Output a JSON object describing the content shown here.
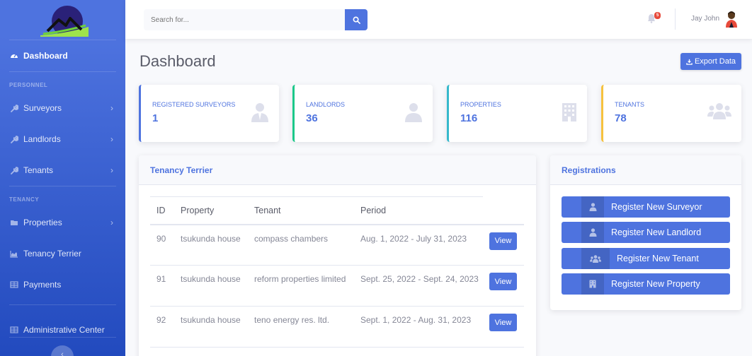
{
  "sidebar": {
    "dashboard": "Dashboard",
    "heading_personnel": "PERSONNEL",
    "surveyors": "Surveyors",
    "landlords": "Landlords",
    "tenants": "Tenants",
    "heading_tenancy": "TENANCY",
    "properties": "Properties",
    "tenancy_terrier": "Tenancy Terrier",
    "payments": "Payments",
    "admin_center": "Administrative Center"
  },
  "topbar": {
    "search_placeholder": "Search for...",
    "notification_count": "5",
    "username": "Jay John"
  },
  "page": {
    "title": "Dashboard",
    "export_label": "Export Data"
  },
  "stats": [
    {
      "label": "REGISTERED SURVEYORS",
      "value": "1",
      "color": "#4e73df",
      "icon": "user-tie-icon"
    },
    {
      "label": "LANDLORDS",
      "value": "36",
      "color": "#1cc88a",
      "icon": "user-icon"
    },
    {
      "label": "PROPERTIES",
      "value": "116",
      "color": "#36b9cc",
      "icon": "building-icon"
    },
    {
      "label": "TENANTS",
      "value": "78",
      "color": "#f6c23e",
      "icon": "users-icon"
    }
  ],
  "terrier": {
    "title": "Tenancy Terrier",
    "headers": [
      "ID",
      "Property",
      "Tenant",
      "Period"
    ],
    "rows": [
      {
        "id": "90",
        "property": "tsukunda house",
        "tenant": "compass chambers",
        "period": "Aug. 1, 2022 - July 31, 2023",
        "action": "View"
      },
      {
        "id": "91",
        "property": "tsukunda house",
        "tenant": "reform properties limited",
        "period": "Sept. 25, 2022 - Sept. 24, 2023",
        "action": "View"
      },
      {
        "id": "92",
        "property": "tsukunda house",
        "tenant": "teno energy res. ltd.",
        "period": "Sept. 1, 2022 - Aug. 31, 2023",
        "action": "View"
      }
    ]
  },
  "registrations": {
    "title": "Registrations",
    "buttons": [
      {
        "label": "Register New Surveyor",
        "icon": "user-tie-icon"
      },
      {
        "label": "Register New Landlord",
        "icon": "user-icon"
      },
      {
        "label": "Register New Tenant",
        "icon": "users-icon"
      },
      {
        "label": "Register New Property",
        "icon": "building-icon"
      }
    ]
  },
  "colors": {
    "primary": "#4e73df",
    "success": "#1cc88a",
    "info": "#36b9cc",
    "warning": "#f6c23e",
    "danger": "#e74a3b"
  }
}
